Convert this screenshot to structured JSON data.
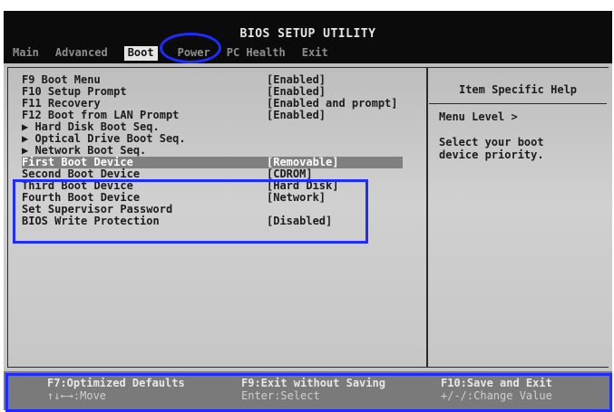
{
  "title": "BIOS SETUP UTILITY",
  "menu": [
    "Main",
    "Advanced",
    "Boot",
    "Power",
    "PC Health",
    "Exit"
  ],
  "active_menu": "Boot",
  "items": [
    {
      "label": "F9 Boot Menu",
      "value": "[Enabled]"
    },
    {
      "label": "F10 Setup Prompt",
      "value": "[Enabled]"
    },
    {
      "label": "F11 Recovery",
      "value": "[Enabled and prompt]"
    },
    {
      "label": "F12 Boot from LAN Prompt",
      "value": "[Enabled]"
    },
    {
      "label": "▶ Hard Disk Boot Seq.",
      "value": ""
    },
    {
      "label": "▶ Optical Drive Boot Seq.",
      "value": ""
    },
    {
      "label": "▶ Network Boot Seq.",
      "value": ""
    },
    {
      "label": "First Boot Device",
      "value": "[Removable]"
    },
    {
      "label": "Second Boot Device",
      "value": "[CDROM]"
    },
    {
      "label": "Third Boot Device",
      "value": "[Hard Disk]"
    },
    {
      "label": "Fourth Boot Device",
      "value": "[Network]"
    },
    {
      "label": "Set Supervisor Password",
      "value": ""
    },
    {
      "label": "BIOS Write Protection",
      "value": "[Disabled]"
    }
  ],
  "help": {
    "title": "Item Specific Help",
    "text": "Menu Level >\n\nSelect your boot\ndevice priority."
  },
  "footer": {
    "left_top": "F7:Optimized Defaults",
    "left_bottom": "↑↓←→:Move",
    "mid_top": "F9:Exit without Saving",
    "mid_bottom": "Enter:Select",
    "right_top": "F10:Save and Exit",
    "right_bottom": "+/-/:Change Value"
  },
  "colors": {
    "highlight_blue": "#1e2cff",
    "panel": "#c9c9c9",
    "header": "#0b0b0b"
  }
}
